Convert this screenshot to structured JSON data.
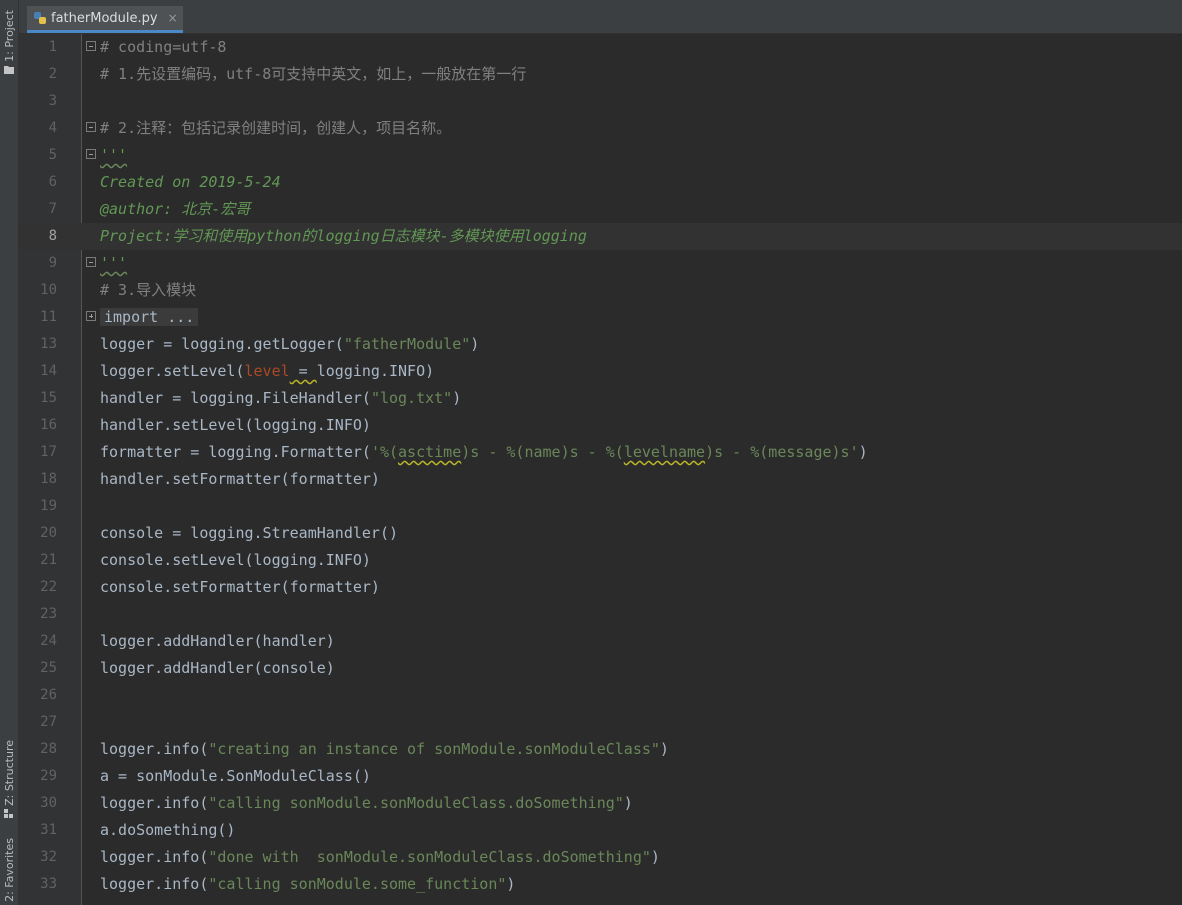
{
  "tool_windows": {
    "project": "1: Project",
    "structure": "Z: Structure",
    "favorites": "2: Favorites"
  },
  "tab": {
    "filename": "fatherModule.py",
    "close": "×"
  },
  "editor": {
    "current_line": "8",
    "lines": [
      {
        "n": "1",
        "segs": [
          {
            "t": "# coding=utf-8",
            "c": "comment"
          }
        ]
      },
      {
        "n": "2",
        "segs": [
          {
            "t": "# 1.先设置编码，utf-8可支持中英文，如上，一般放在第一行",
            "c": "comment"
          }
        ]
      },
      {
        "n": "3",
        "segs": []
      },
      {
        "n": "4",
        "segs": [
          {
            "t": "# 2.注释：包括记录创建时间，创建人，项目名称。",
            "c": "comment"
          }
        ]
      },
      {
        "n": "5",
        "segs": [
          {
            "t": "'''",
            "c": "doc-sq"
          }
        ]
      },
      {
        "n": "6",
        "segs": [
          {
            "t": "Created on 2019-5-24",
            "c": "doc"
          }
        ]
      },
      {
        "n": "7",
        "segs": [
          {
            "t": "@author: 北京-宏哥",
            "c": "doc"
          }
        ]
      },
      {
        "n": "8",
        "segs": [
          {
            "t": "Project:学习和使用python的logging日志模块-多模块使用logging",
            "c": "doc"
          }
        ]
      },
      {
        "n": "9",
        "segs": [
          {
            "t": "'''",
            "c": "doc-sq"
          }
        ]
      },
      {
        "n": "10",
        "segs": [
          {
            "t": "# 3.导入模块",
            "c": "comment"
          }
        ]
      },
      {
        "n": "11",
        "segs": [
          {
            "t": "import ...",
            "c": "fold"
          }
        ]
      },
      {
        "n": "13",
        "segs": [
          {
            "t": "logger = logging.getLogger(",
            "c": ""
          },
          {
            "t": "\"fatherModule\"",
            "c": "str"
          },
          {
            "t": ")",
            "c": ""
          }
        ]
      },
      {
        "n": "14",
        "segs": [
          {
            "t": "logger.setLevel(",
            "c": ""
          },
          {
            "t": "level",
            "c": "param"
          },
          {
            "t": " = ",
            "c": "sq"
          },
          {
            "t": "logging.INFO)",
            "c": ""
          }
        ]
      },
      {
        "n": "15",
        "segs": [
          {
            "t": "handler = logging.FileHandler(",
            "c": ""
          },
          {
            "t": "\"log.txt\"",
            "c": "str"
          },
          {
            "t": ")",
            "c": ""
          }
        ]
      },
      {
        "n": "16",
        "segs": [
          {
            "t": "handler.setLevel(logging.INFO)",
            "c": ""
          }
        ]
      },
      {
        "n": "17",
        "segs": [
          {
            "t": "formatter = logging.Formatter(",
            "c": ""
          },
          {
            "t": "'%(",
            "c": "str"
          },
          {
            "t": "asctime",
            "c": "str-sq"
          },
          {
            "t": ")s - %(name)s - %(",
            "c": "str"
          },
          {
            "t": "levelname",
            "c": "str-sq"
          },
          {
            "t": ")s - %(message)s'",
            "c": "str"
          },
          {
            "t": ")",
            "c": ""
          }
        ]
      },
      {
        "n": "18",
        "segs": [
          {
            "t": "handler.setFormatter(formatter)",
            "c": ""
          }
        ]
      },
      {
        "n": "19",
        "segs": []
      },
      {
        "n": "20",
        "segs": [
          {
            "t": "console = logging.StreamHandler()",
            "c": ""
          }
        ]
      },
      {
        "n": "21",
        "segs": [
          {
            "t": "console.setLevel(logging.INFO)",
            "c": ""
          }
        ]
      },
      {
        "n": "22",
        "segs": [
          {
            "t": "console.setFormatter(formatter)",
            "c": ""
          }
        ]
      },
      {
        "n": "23",
        "segs": []
      },
      {
        "n": "24",
        "segs": [
          {
            "t": "logger.addHandler(handler)",
            "c": ""
          }
        ]
      },
      {
        "n": "25",
        "segs": [
          {
            "t": "logger.addHandler(console)",
            "c": ""
          }
        ]
      },
      {
        "n": "26",
        "segs": []
      },
      {
        "n": "27",
        "segs": []
      },
      {
        "n": "28",
        "segs": [
          {
            "t": "logger.info(",
            "c": ""
          },
          {
            "t": "\"creating an instance of sonModule.sonModuleClass\"",
            "c": "str"
          },
          {
            "t": ")",
            "c": ""
          }
        ]
      },
      {
        "n": "29",
        "segs": [
          {
            "t": "a = sonModule.SonModuleClass()",
            "c": ""
          }
        ]
      },
      {
        "n": "30",
        "segs": [
          {
            "t": "logger.info(",
            "c": ""
          },
          {
            "t": "\"calling sonModule.sonModuleClass.doSomething\"",
            "c": "str"
          },
          {
            "t": ")",
            "c": ""
          }
        ]
      },
      {
        "n": "31",
        "segs": [
          {
            "t": "a.doSomething()",
            "c": ""
          }
        ]
      },
      {
        "n": "32",
        "segs": [
          {
            "t": "logger.info(",
            "c": ""
          },
          {
            "t": "\"done with  sonModule.sonModuleClass.doSomething\"",
            "c": "str"
          },
          {
            "t": ")",
            "c": ""
          }
        ]
      },
      {
        "n": "33",
        "segs": [
          {
            "t": "logger.info(",
            "c": ""
          },
          {
            "t": "\"calling sonModule.some_function\"",
            "c": "str"
          },
          {
            "t": ")",
            "c": ""
          }
        ]
      }
    ]
  }
}
